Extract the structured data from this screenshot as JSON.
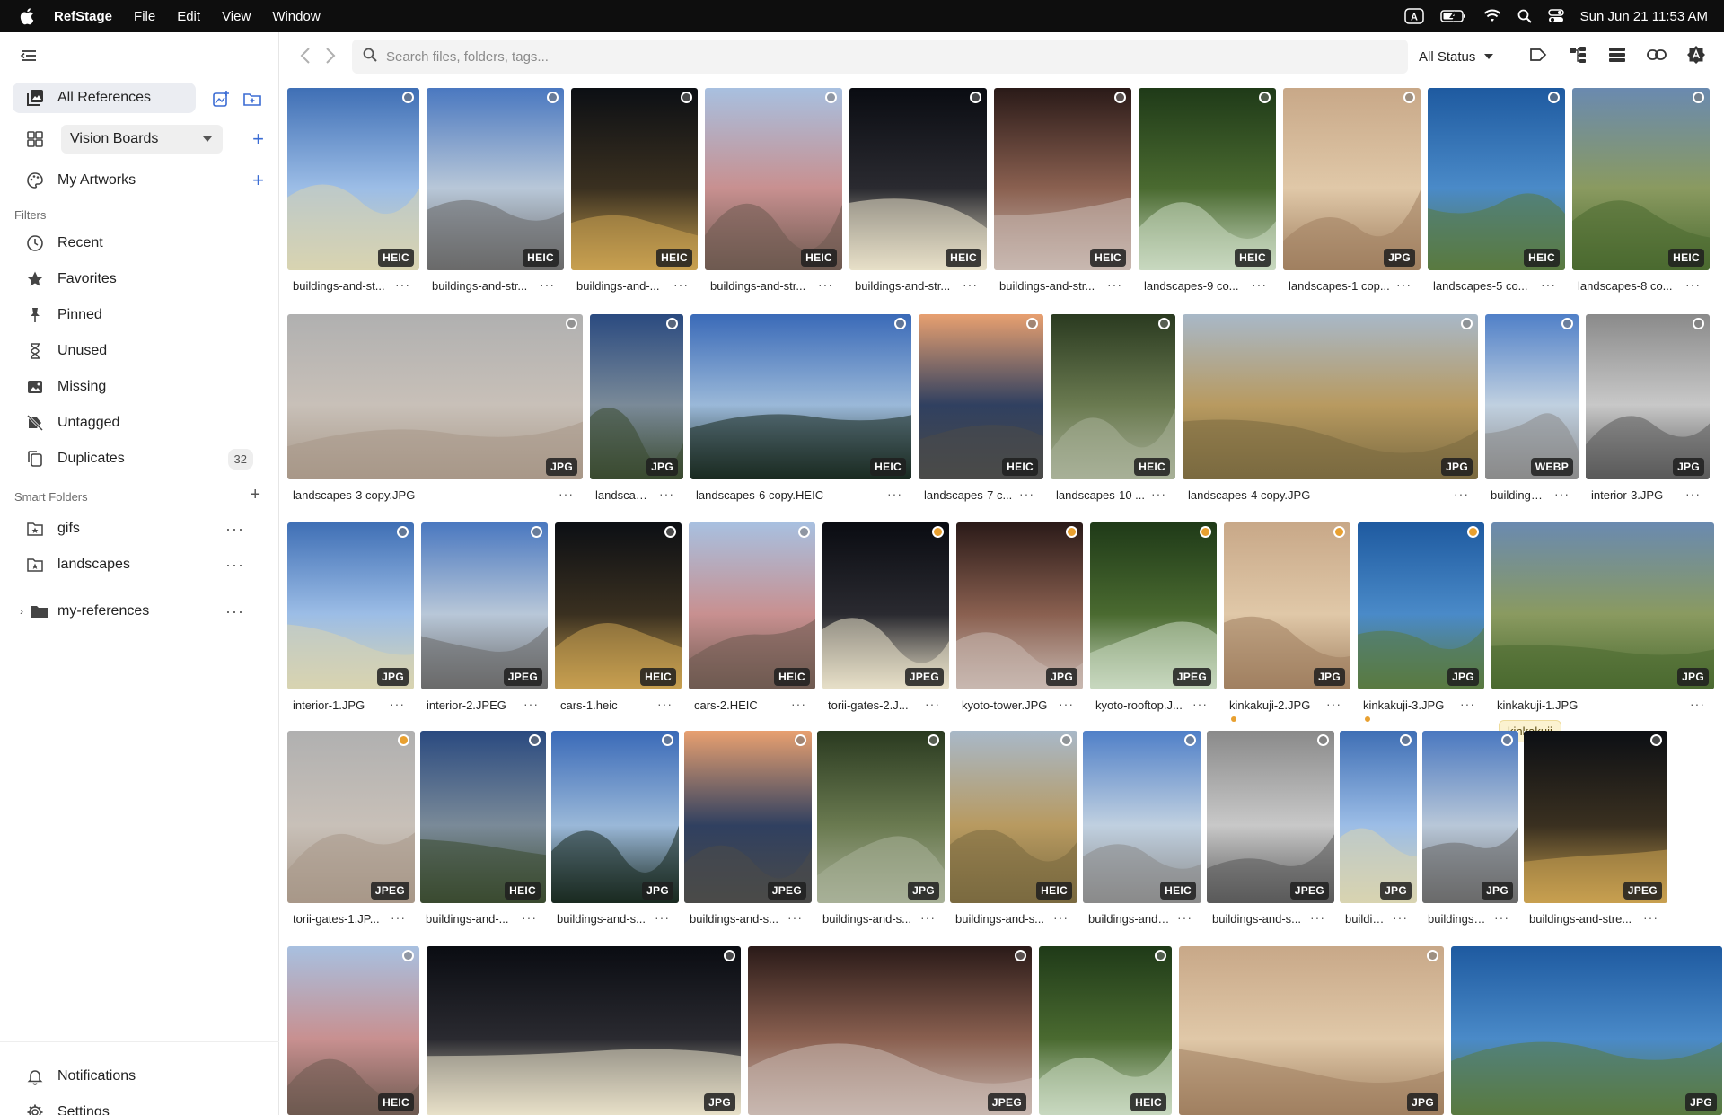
{
  "menubar": {
    "app_name": "RefStage",
    "menus": [
      "File",
      "Edit",
      "View",
      "Window"
    ],
    "clock": "Sun Jun 21  11:53 AM",
    "input_badge": "A"
  },
  "sidebar": {
    "all_references": "All References",
    "vision_boards": "Vision Boards",
    "my_artworks": "My Artworks",
    "filters_heading": "Filters",
    "filters": [
      {
        "label": "Recent",
        "icon": "clock-icon"
      },
      {
        "label": "Favorites",
        "icon": "star-icon"
      },
      {
        "label": "Pinned",
        "icon": "pin-icon"
      },
      {
        "label": "Unused",
        "icon": "hourglass-icon"
      },
      {
        "label": "Missing",
        "icon": "missing-image-icon"
      },
      {
        "label": "Untagged",
        "icon": "untagged-icon"
      },
      {
        "label": "Duplicates",
        "icon": "duplicates-icon",
        "count": "32"
      }
    ],
    "smart_folders_heading": "Smart Folders",
    "smart_folders": [
      {
        "label": "gifs"
      },
      {
        "label": "landscapes"
      }
    ],
    "folder": "my-references",
    "notifications": "Notifications",
    "settings": "Settings"
  },
  "toolbar": {
    "search_placeholder": "Search files, folders, tags...",
    "status_filter": "All Status"
  },
  "colors": {
    "accent": "#3b6cd4",
    "tag_dot": "#e8a030",
    "active_row": "#ebedf2"
  },
  "grid": {
    "row1": [
      {
        "name": "buildings-and-st...",
        "format": "HEIC",
        "sel": "grey"
      },
      {
        "name": "buildings-and-str...",
        "format": "HEIC",
        "sel": "grey"
      },
      {
        "name": "buildings-and-...",
        "format": "HEIC",
        "sel": "grey"
      },
      {
        "name": "buildings-and-str...",
        "format": "HEIC",
        "sel": "grey"
      },
      {
        "name": "buildings-and-str...",
        "format": "HEIC",
        "sel": "grey"
      },
      {
        "name": "buildings-and-str...",
        "format": "HEIC",
        "sel": "grey"
      },
      {
        "name": "landscapes-9 co...",
        "format": "HEIC",
        "sel": "grey"
      },
      {
        "name": "landscapes-1 cop...",
        "format": "JPG",
        "sel": "grey"
      },
      {
        "name": "landscapes-5 co...",
        "format": "HEIC",
        "sel": "grey"
      },
      {
        "name": "landscapes-8 co...",
        "format": "HEIC",
        "sel": "grey"
      }
    ],
    "row2": [
      {
        "name": "landscapes-3 copy.JPG",
        "format": "JPG",
        "sel": "grey"
      },
      {
        "name": "landscapes...",
        "format": "JPG",
        "sel": "grey"
      },
      {
        "name": "landscapes-6 copy.HEIC",
        "format": "HEIC",
        "sel": "grey"
      },
      {
        "name": "landscapes-7 c...",
        "format": "HEIC",
        "sel": "grey"
      },
      {
        "name": "landscapes-10 ...",
        "format": "HEIC",
        "sel": "grey"
      },
      {
        "name": "landscapes-4 copy.JPG",
        "format": "JPG",
        "sel": "grey"
      },
      {
        "name": "buildings-a...",
        "format": "WEBP",
        "sel": "grey"
      },
      {
        "name": "interior-3.JPG",
        "format": "JPG",
        "sel": "grey"
      }
    ],
    "row3": [
      {
        "name": "interior-1.JPG",
        "format": "JPG",
        "sel": "grey"
      },
      {
        "name": "interior-2.JPEG",
        "format": "JPEG",
        "sel": "grey"
      },
      {
        "name": "cars-1.heic",
        "format": "HEIC",
        "sel": "grey"
      },
      {
        "name": "cars-2.HEIC",
        "format": "HEIC",
        "sel": "grey"
      },
      {
        "name": "torii-gates-2.J...",
        "format": "JPEG",
        "sel": "orange"
      },
      {
        "name": "kyoto-tower.JPG",
        "format": "JPG",
        "sel": "orange"
      },
      {
        "name": "kyoto-rooftop.J...",
        "format": "JPEG",
        "sel": "orange"
      },
      {
        "name": "kinkakuji-2.JPG",
        "format": "JPG",
        "sel": "orange"
      },
      {
        "name": "kinkakuji-3.JPG",
        "format": "JPG",
        "sel": "orange"
      },
      {
        "name": "kinkakuji-1.JPG",
        "format": "JPG",
        "sel": "none",
        "tag": "kinkakuji"
      }
    ],
    "row4": [
      {
        "name": "torii-gates-1.JP...",
        "format": "JPEG",
        "sel": "orange"
      },
      {
        "name": "buildings-and-...",
        "format": "HEIC",
        "sel": "grey"
      },
      {
        "name": "buildings-and-s...",
        "format": "JPG",
        "sel": "grey"
      },
      {
        "name": "buildings-and-s...",
        "format": "JPEG",
        "sel": "grey"
      },
      {
        "name": "buildings-and-s...",
        "format": "JPG",
        "sel": "grey"
      },
      {
        "name": "buildings-and-s...",
        "format": "HEIC",
        "sel": "grey"
      },
      {
        "name": "buildings-and-st...",
        "format": "HEIC",
        "sel": "grey"
      },
      {
        "name": "buildings-and-s...",
        "format": "JPEG",
        "sel": "grey"
      },
      {
        "name": "buildings-a...",
        "format": "JPG",
        "sel": "grey"
      },
      {
        "name": "buildings-a...",
        "format": "JPG",
        "sel": "grey"
      },
      {
        "name": "buildings-and-stre...",
        "format": "JPEG",
        "sel": "grey"
      }
    ],
    "row5": [
      {
        "format": "HEIC",
        "sel": "grey"
      },
      {
        "format": "JPG",
        "sel": "grey"
      },
      {
        "format": "JPEG",
        "sel": "grey"
      },
      {
        "format": "HEIC",
        "sel": "grey"
      },
      {
        "format": "JPG",
        "sel": "grey"
      },
      {
        "format": "JPG",
        "sel": "none"
      }
    ]
  }
}
